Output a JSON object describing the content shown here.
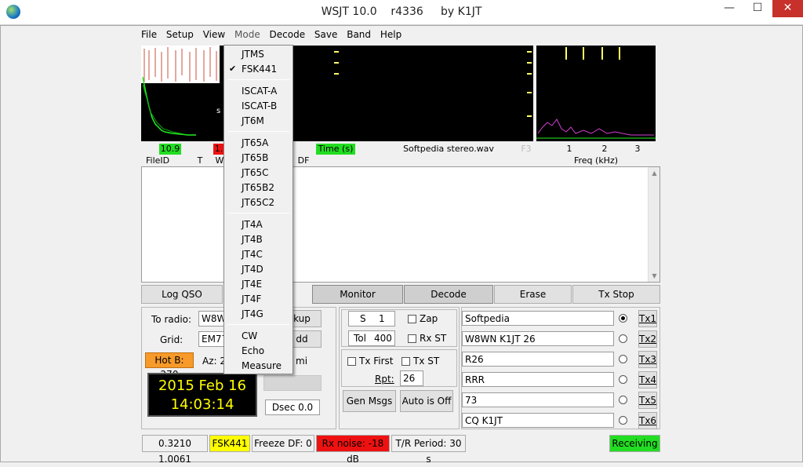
{
  "window": {
    "title": "WSJT 10.0    r4336     by K1JT",
    "minimize": "—",
    "maximize": "☐",
    "close": "✕"
  },
  "menu": [
    "File",
    "Setup",
    "View",
    "Mode",
    "Decode",
    "Save",
    "Band",
    "Help"
  ],
  "waterfall": {
    "level": "10.9",
    "level2": "1.",
    "time_label": "Time (s)",
    "filename": "Softpedia stereo.wav",
    "f_label": "F3",
    "freq_ticks": [
      "1",
      "2",
      "3"
    ],
    "freq_label": "Freq (kHz)"
  },
  "columns": {
    "fileid": "FileID",
    "t": "T",
    "w": "W",
    "df": "DF"
  },
  "buttons": {
    "log_qso": "Log QSO",
    "monitor": "Monitor",
    "decode": "Decode",
    "erase": "Erase",
    "tx_stop": "Tx Stop"
  },
  "station": {
    "to_radio_label": "To radio:",
    "to_radio_value": "W8W",
    "lookup": "kup",
    "grid_label": "Grid:",
    "grid_value": "EM77",
    "add": "dd",
    "hot_b": "Hot B: 270",
    "az": "Az: 2",
    "mi": "mi",
    "date": "2015 Feb 16",
    "time": "14:03:14",
    "dsec": "Dsec  0.0"
  },
  "controls": {
    "s_label": "S",
    "s_value": "1",
    "zap": "Zap",
    "tol_label": "Tol",
    "tol_value": "400",
    "rx_st": "Rx ST",
    "tx_first": "Tx First",
    "tx_st": "Tx ST",
    "rpt_label": "Rpt:",
    "rpt_value": "26",
    "gen_msgs": "Gen Msgs",
    "auto": "Auto is Off"
  },
  "tx_messages": [
    {
      "text": "Softpedia",
      "label": "Tx1",
      "selected": true
    },
    {
      "text": "W8WN K1JT 26",
      "label": "Tx2",
      "selected": false
    },
    {
      "text": "R26",
      "label": "Tx3",
      "selected": false
    },
    {
      "text": "RRR",
      "label": "Tx4",
      "selected": false
    },
    {
      "text": "73",
      "label": "Tx5",
      "selected": false
    },
    {
      "text": "CQ K1JT",
      "label": "Tx6",
      "selected": false
    }
  ],
  "statusbar": {
    "ratio": "0.3210  1.0061",
    "mode": "FSK441",
    "freeze": "Freeze DF:   0",
    "rx_noise": "Rx noise: -18 dB",
    "tr_period": "T/R Period: 30 s",
    "receiving": "Receiving"
  },
  "mode_menu": {
    "groups": [
      [
        "JTMS",
        "FSK441"
      ],
      [
        "ISCAT-A",
        "ISCAT-B",
        "JT6M"
      ],
      [
        "JT65A",
        "JT65B",
        "JT65C",
        "JT65B2",
        "JT65C2"
      ],
      [
        "JT4A",
        "JT4B",
        "JT4C",
        "JT4D",
        "JT4E",
        "JT4F",
        "JT4G"
      ],
      [
        "CW",
        "Echo",
        "Measure"
      ]
    ],
    "checked": "FSK441",
    "check_mark": "✔"
  },
  "colors": {
    "green": "#22dd22",
    "red": "#ee1111",
    "yellow": "#ffff00",
    "orange": "#f79a2a"
  }
}
